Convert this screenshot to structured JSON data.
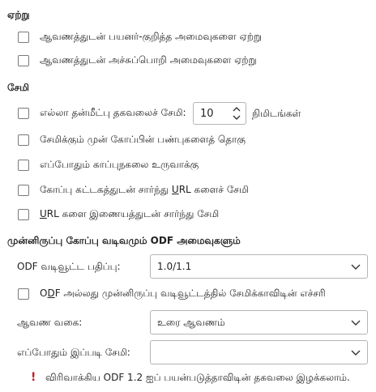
{
  "load": {
    "title": "ஏற்று",
    "options": [
      {
        "label": "ஆவணத்துடன் பயனர்-குறித்த அமைவுகளை ஏற்று",
        "checked": false
      },
      {
        "label": "ஆவணத்துடன் அச்சுப்பொறி அமைவுகளை ஏற்று",
        "checked": false
      }
    ]
  },
  "save": {
    "title": "சேமி",
    "autorecovery_label": "எல்லா தன்மீட்பு தகவலைச் சேமி:",
    "autorecovery_checked": false,
    "autorecovery_value": "10",
    "autorecovery_unit": "நிமிடங்கள்",
    "options": [
      {
        "label": "சேமிக்கும் முன் கோப்பின் பண்புகளைத் தொகு",
        "checked": false
      },
      {
        "label": "எப்போதும் காப்புநகலை உருவாக்கு",
        "checked": false
      },
      {
        "label_pre": "கோப்பு கட்டகத்துடன் சார்ந்து ",
        "label_u": "U",
        "label_post": "RL களைச் சேமி",
        "checked": false
      },
      {
        "label_pre": "",
        "label_u": "U",
        "label_post": "RL களை இணையத்துடன் சார்ந்து சேமி",
        "checked": false
      }
    ]
  },
  "odf": {
    "title": "முன்னிருப்பு கோப்பு வடிவமும் ODF அமைவுகளும்",
    "version_label": "ODF வடிவூட்ட பதிப்பு:",
    "version_value": "1.0/1.1",
    "warn_checkbox_pre": "O",
    "warn_checkbox_u": "D",
    "warn_checkbox_post": "F அல்லது முன்னிருப்பு வடிவூட்டத்தில் சேமிக்காவிடின் எச்சரி",
    "warn_checked": false,
    "doc_type_label": "ஆவண வகை:",
    "doc_type_value": "உரை ஆவணம்",
    "always_save_label": "எப்போதும் இப்படி சேமி:",
    "always_save_value": "",
    "warning_icon": "!",
    "warning_text": "விரிவாக்கிய ODF 1.2 ஐப் பயன்படுத்தாவிடின் தகவலை இழக்கலாம்."
  },
  "colors": {
    "warning": "#c01c28",
    "border": "#b5b5b5"
  }
}
